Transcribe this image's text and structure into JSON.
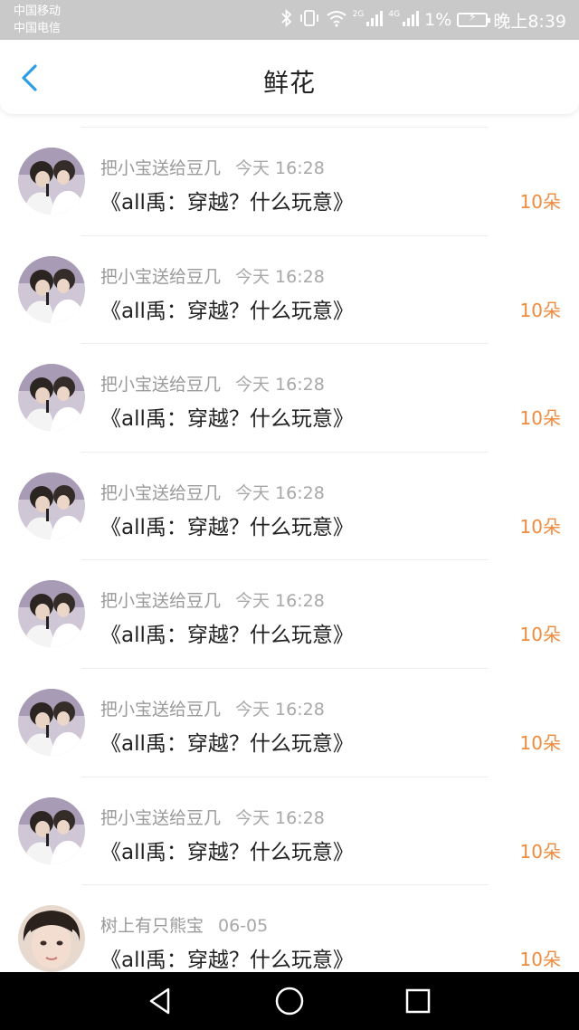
{
  "status_bar": {
    "carrier_1": "中国移动",
    "carrier_2": "中国电信",
    "net_1": "2G",
    "net_2": "4G",
    "battery_percent": "1%",
    "time": "晚上8:39"
  },
  "header": {
    "title": "鲜花",
    "back_icon": "chevron-left-icon"
  },
  "colors": {
    "accent": "#2f9ee8",
    "amount": "#f08a3c",
    "meta_text": "#9a9a9a"
  },
  "items": [
    {
      "sender": "把小宝送给豆几",
      "time": "今天 16:28",
      "book": "《all禹：穿越？什么玩意》",
      "amount": "10朵",
      "avatar": "avatar-photo-mic"
    },
    {
      "sender": "把小宝送给豆几",
      "time": "今天 16:28",
      "book": "《all禹：穿越？什么玩意》",
      "amount": "10朵",
      "avatar": "avatar-photo-mic"
    },
    {
      "sender": "把小宝送给豆几",
      "time": "今天 16:28",
      "book": "《all禹：穿越？什么玩意》",
      "amount": "10朵",
      "avatar": "avatar-photo-mic"
    },
    {
      "sender": "把小宝送给豆几",
      "time": "今天 16:28",
      "book": "《all禹：穿越？什么玩意》",
      "amount": "10朵",
      "avatar": "avatar-photo-mic"
    },
    {
      "sender": "把小宝送给豆几",
      "time": "今天 16:28",
      "book": "《all禹：穿越？什么玩意》",
      "amount": "10朵",
      "avatar": "avatar-photo-mic"
    },
    {
      "sender": "把小宝送给豆几",
      "time": "今天 16:28",
      "book": "《all禹：穿越？什么玩意》",
      "amount": "10朵",
      "avatar": "avatar-photo-mic"
    },
    {
      "sender": "把小宝送给豆几",
      "time": "今天 16:28",
      "book": "《all禹：穿越？什么玩意》",
      "amount": "10朵",
      "avatar": "avatar-photo-mic"
    },
    {
      "sender": "树上有只熊宝",
      "time": "06-05",
      "book": "《all禹：穿越？什么玩意》",
      "amount": "10朵",
      "avatar": "avatar-photo-face"
    }
  ],
  "nav": {
    "back": "triangle-back-icon",
    "home": "circle-home-icon",
    "recents": "square-recents-icon"
  }
}
